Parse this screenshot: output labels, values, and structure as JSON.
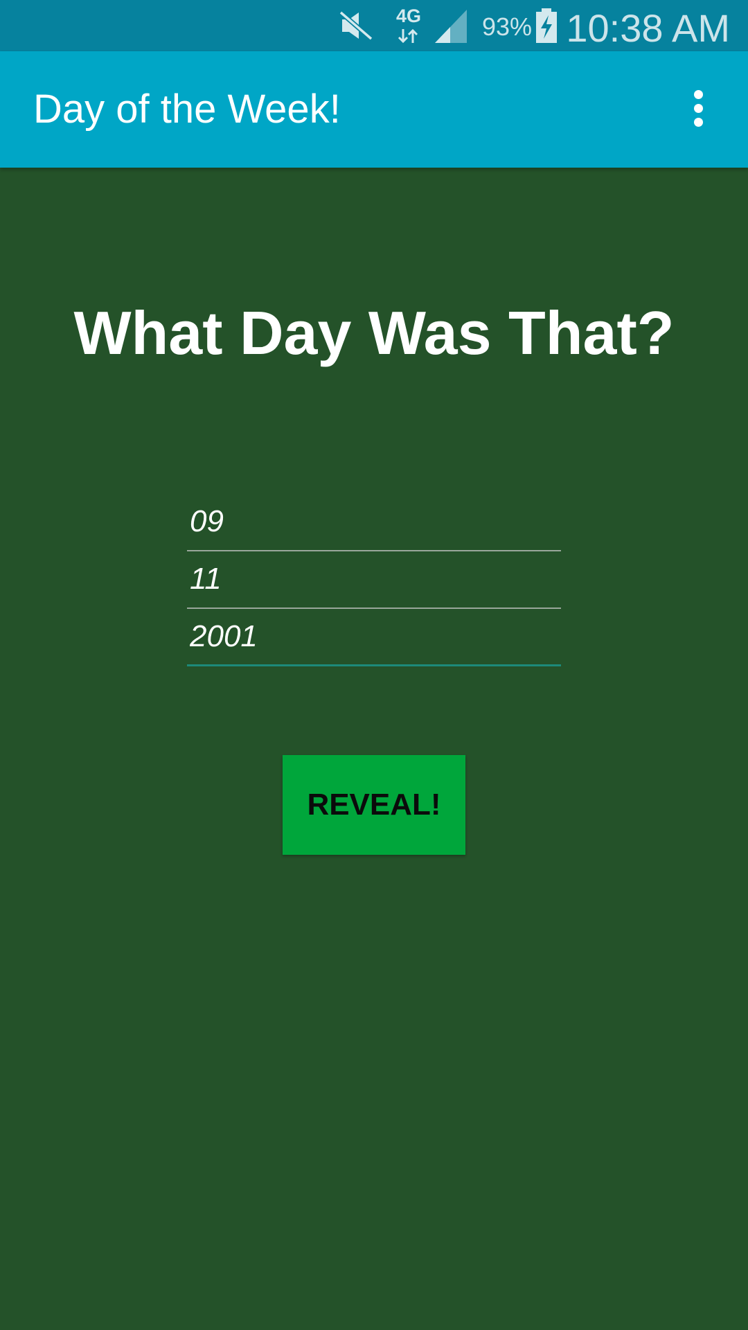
{
  "status_bar": {
    "network_label": "4G",
    "battery_percent": "93%",
    "time": "10:38 AM",
    "icons": [
      "mute-icon",
      "network-4g-icon",
      "signal-icon",
      "battery-charging-icon"
    ]
  },
  "app_bar": {
    "title": "Day of the Week!",
    "overflow_icon": "more-vert-icon"
  },
  "main": {
    "heading": "What Day Was That?",
    "fields": [
      {
        "value": "09",
        "focused": false
      },
      {
        "value": "11",
        "focused": false
      },
      {
        "value": "2001",
        "focused": true
      }
    ],
    "reveal_label": "REVEAL!"
  },
  "colors": {
    "status_bar": "#06829e",
    "app_bar": "#00a6c6",
    "background": "#245229",
    "button": "#00a63b",
    "focus_underline": "#1d8a7a"
  }
}
